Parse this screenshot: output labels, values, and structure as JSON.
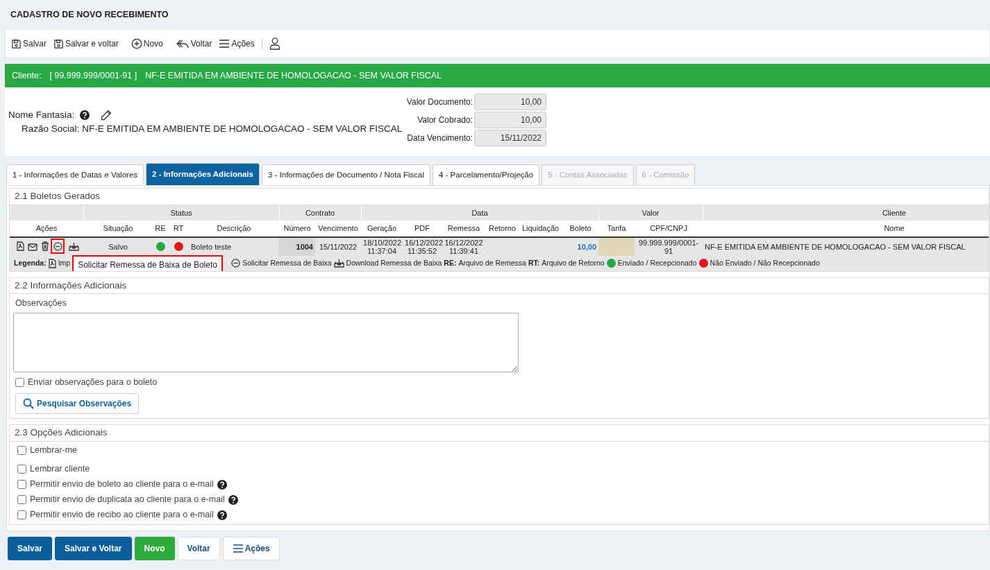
{
  "title": "CADASTRO DE NOVO RECEBIMENTO",
  "toolbar": [
    {
      "kind": "save",
      "label": "Salvar"
    },
    {
      "kind": "saveback",
      "label": "Salvar e voltar"
    },
    {
      "kind": "new",
      "label": "Novo"
    },
    {
      "kind": "back",
      "label": "Voltar"
    },
    {
      "kind": "menu",
      "label": "Ações"
    },
    {
      "kind": "user"
    }
  ],
  "client_bar": {
    "label": "Cliente:",
    "document": "[ 99.999.999/0001-91 ]",
    "name": "NF-E EMITIDA EM AMBIENTE DE HOMOLOGACAO - SEM VALOR FISCAL"
  },
  "client_info": {
    "nome_fantasia_label": "Nome Fantasia:",
    "razao_social_label": "Razão Social:",
    "razao_social": "NF-E EMITIDA EM AMBIENTE DE HOMOLOGACAO - SEM VALOR FISCAL"
  },
  "values": [
    {
      "label": "Valor Documento:",
      "value": "10,00"
    },
    {
      "label": "Valor Cobrado:",
      "value": "10,00"
    },
    {
      "label": "Data Vencimento:",
      "value": "15/11/2022"
    }
  ],
  "tabs": [
    {
      "label": "1 - Informações de Datas e Valores",
      "selected": false,
      "disabled": false
    },
    {
      "label": "2 - Informações Adicionais",
      "selected": true,
      "disabled": false
    },
    {
      "label": "3 - Informações de Documento / Nota Fiscal",
      "selected": false,
      "disabled": false
    },
    {
      "label": "4 - Parcelamento/Projeção",
      "selected": false,
      "disabled": false
    },
    {
      "label": "5 - Contas Associadas",
      "selected": false,
      "disabled": true
    },
    {
      "label": "6 - Comissão",
      "selected": false,
      "disabled": true
    }
  ],
  "boletos": {
    "title": "2.1 Boletos Gerados",
    "group_headers": [
      "Status",
      "Contrato",
      "Data",
      "Valor",
      "Cliente"
    ],
    "columns": [
      "Ações",
      "Situação",
      "RE",
      "RT",
      "Descrição",
      "Número",
      "Vencimento",
      "Geração",
      "PDF",
      "Remessa",
      "Retorno",
      "Liquidação",
      "Boleto",
      "Tarifa",
      "CPF/CNPJ",
      "Nome"
    ],
    "rows": [
      {
        "actions": [
          {
            "kind": "pdf",
            "highlighted": false
          },
          {
            "kind": "mail",
            "highlighted": false
          },
          {
            "kind": "trash",
            "highlighted": false
          },
          {
            "kind": "baixa",
            "highlighted": true
          },
          {
            "kind": "download",
            "highlighted": false
          }
        ],
        "situacao": "Salvo",
        "re_sent": true,
        "rt_sent": false,
        "descricao": "Boleto teste",
        "numero": "1004",
        "vencimento": "15/11/2022",
        "geracao": "18/10/2022\n11:37:04",
        "pdf": "16/12/2022\n11:35:52",
        "remessa": "16/12/2022\n11:39:41",
        "boleto": "10,00",
        "cpf_cnpj": "99.999.999/0001-91",
        "nome": "NF-E EMITIDA EM AMBIENTE DE HOMOLOGACAO - SEM VALOR FISCAL"
      }
    ],
    "legend": [
      {
        "kind": "label",
        "text": "Legenda:"
      },
      {
        "kind": "pdf",
        "text": "Imp"
      },
      {
        "kind": "baixa",
        "text": "Solicitar Remessa de Baixa"
      },
      {
        "kind": "download",
        "text": "Download Remessa de Baixa"
      },
      {
        "kind": "abbr",
        "abbr": "RE:",
        "text": "Arquivo de Remessa"
      },
      {
        "kind": "abbr",
        "abbr": "RT:",
        "text": "Arquivo de Retorno"
      },
      {
        "kind": "dot",
        "sent": true,
        "text": "Enviado / Recepcionado"
      },
      {
        "kind": "dot",
        "sent": false,
        "text": "Não Enviado / Não Recepcionado"
      }
    ],
    "tooltip": "Solicitar Remessa de Baixa de Boleto"
  },
  "info": {
    "title": "2.2 Informações Adicionais",
    "label": "Observações",
    "send_checkbox": {
      "label": "Enviar observações para o boleto",
      "checked": false
    },
    "search_button": "Pesquisar Observações"
  },
  "options": {
    "title": "2.3 Opções Adicionais",
    "items": [
      {
        "label": "Lembrar-me",
        "checked": false,
        "help": false
      },
      {
        "label": "Lembrar cliente",
        "checked": false,
        "help": false
      },
      {
        "label": "Permitir envio de boleto ao cliente para o e-mail",
        "checked": false,
        "help": true
      },
      {
        "label": "Permitir envio de duplicata ao cliente para o e-mail",
        "checked": false,
        "help": true
      },
      {
        "label": "Permitir envio de recibo ao cliente para o e-mail",
        "checked": false,
        "help": true
      }
    ]
  },
  "footer": [
    {
      "kind": "primary",
      "label": "Salvar"
    },
    {
      "kind": "primary",
      "label": "Salvar e Voltar"
    },
    {
      "kind": "success",
      "label": "Novo"
    },
    {
      "kind": "plain",
      "label": "Voltar"
    },
    {
      "kind": "menu",
      "label": "Ações"
    }
  ]
}
